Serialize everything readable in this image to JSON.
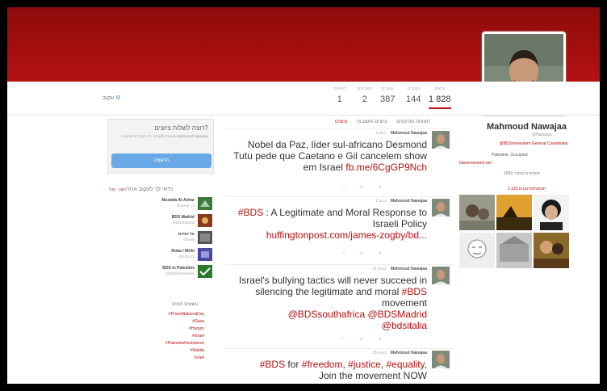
{
  "header": {
    "color": "#a50f0f"
  },
  "profile": {
    "name": "Mahmoud Nawajaa",
    "handle": "@Nawajaa",
    "bio": "@BDSmovement General Coordinator",
    "location": "Palestine, Occupied",
    "link": "bdsmovement.net",
    "joined": "2009 נצטרף בדצמבר",
    "photos_label": "1,113 תמונות/סרטונים"
  },
  "stats": [
    {
      "label": "ציוצים",
      "value": "1 828"
    },
    {
      "label": "נעקבים",
      "value": "144"
    },
    {
      "label": "עוקבים",
      "value": "387"
    },
    {
      "label": "מועדפים",
      "value": "2"
    },
    {
      "label": "רשימות",
      "value": "1"
    }
  ],
  "follow_control": {
    "label": "עקוב",
    "gear": "⚙"
  },
  "tabs": [
    "ציוצים",
    "ציוצים ותשובות",
    "תמונות וסרטונים"
  ],
  "dm_box": {
    "title": "רוצה לשלוח ציוצים?",
    "subtitle": "הצטרף לטוויטר כדי לקבל עדכונים מ-Mahmoud Nawajaa",
    "button": "הרשמה"
  },
  "who_to_follow": {
    "title": "כדאי לך לעקוב אחר",
    "controls": "רענן · הכל",
    "items": [
      {
        "name": "Mustafa Al-Azhar",
        "handle": "@azhar_m",
        "color": "#3d7a3d"
      },
      {
        "name": "BDS Madrid",
        "handle": "@BDSMadrid",
        "color": "#8a3a1a"
      },
      {
        "name": "על אודות",
        "handle": "@sulla",
        "color": "#555555"
      },
      {
        "name": "Roba / Mirhi",
        "handle": "@roba_m",
        "color": "#4a4aa0"
      },
      {
        "name": "BDS in Palestine",
        "handle": "@BDSinPalestine",
        "color": "#2a7a2a"
      }
    ]
  },
  "trends": {
    "title": "נושאים חמים",
    "items": [
      "#PrisonNationalDay",
      "#Gaza",
      "#Hungry",
      "#Israel",
      "#PalestineResistance",
      "#Nakba",
      "Israel"
    ]
  },
  "tweets": [
    {
      "date": "3 בנוב",
      "user": "Mahmoud Nawajaa",
      "text": "Nobel da Paz, líder sul-africano Desmond Tutu pede que Caetano e Gil cancelem show em Israel ",
      "link": "fb.me/6CgGP9Nch"
    },
    {
      "date": "1 בנוב",
      "user": "Mahmoud Nawajaa",
      "hashtag": "#BDS",
      "text": " : A Legitimate and Moral Response to Israeli Policy",
      "link": "huffingtonpost.com/james-zogby/bd..."
    },
    {
      "date": "31 באוק",
      "user": "Mahmoud Nawajaa",
      "text_a": "Israel's bullying tactics will never succeed in silencing the legitimate and moral ",
      "hashtag": "#BDS",
      "text_b": " movement",
      "mentions": "@BDSsouthafrica @BDSMadrid",
      "mention_last": "@bdsitalia"
    },
    {
      "date": "28 באוק",
      "user": "Mahmoud Nawajaa",
      "h1": "#BDS",
      "t1": " for ",
      "h2": "#freedom",
      "t2": ", ",
      "h3": "#justice",
      "t3": ", ",
      "h4": "#equality",
      "t4": ",",
      "text_b": "Join the movement NOW"
    }
  ]
}
